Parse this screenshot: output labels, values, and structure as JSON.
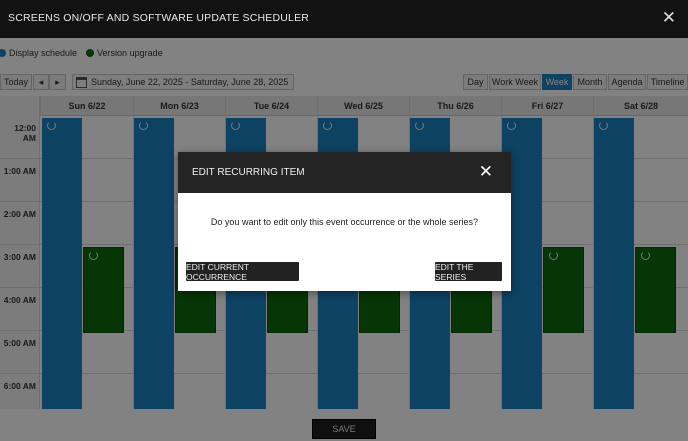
{
  "window": {
    "title": "SCREENS ON/OFF AND SOFTWARE UPDATE SCHEDULER",
    "close_symbol": "✕"
  },
  "legend": [
    {
      "label": "Display schedule",
      "color": "#1a82c2"
    },
    {
      "label": "Version upgrade",
      "color": "#0d6b0d"
    }
  ],
  "toolbar": {
    "today": "Today",
    "prev": "◂",
    "next": "▸",
    "date_range": "Sunday, June 22, 2025 - Saturday, June 28, 2025",
    "views": [
      "Day",
      "Work Week",
      "Week",
      "Month",
      "Agenda",
      "Timeline"
    ],
    "active_view": "Week"
  },
  "days": [
    "Sun 6/22",
    "Mon 6/23",
    "Tue 6/24",
    "Wed 6/25",
    "Thu 6/26",
    "Fri 6/27",
    "Sat 6/28"
  ],
  "times": [
    "12:00 AM",
    "1:00 AM",
    "2:00 AM",
    "3:00 AM",
    "4:00 AM",
    "5:00 AM",
    "6:00 AM"
  ],
  "footer": {
    "save": "SAVE"
  },
  "dialog": {
    "title": "EDIT RECURRING ITEM",
    "close_symbol": "✕",
    "message": "Do you want to edit only this event occurrence or the whole series?",
    "btn_current": "EDIT CURRENT OCCURRENCE",
    "btn_series": "EDIT THE SERIES"
  }
}
